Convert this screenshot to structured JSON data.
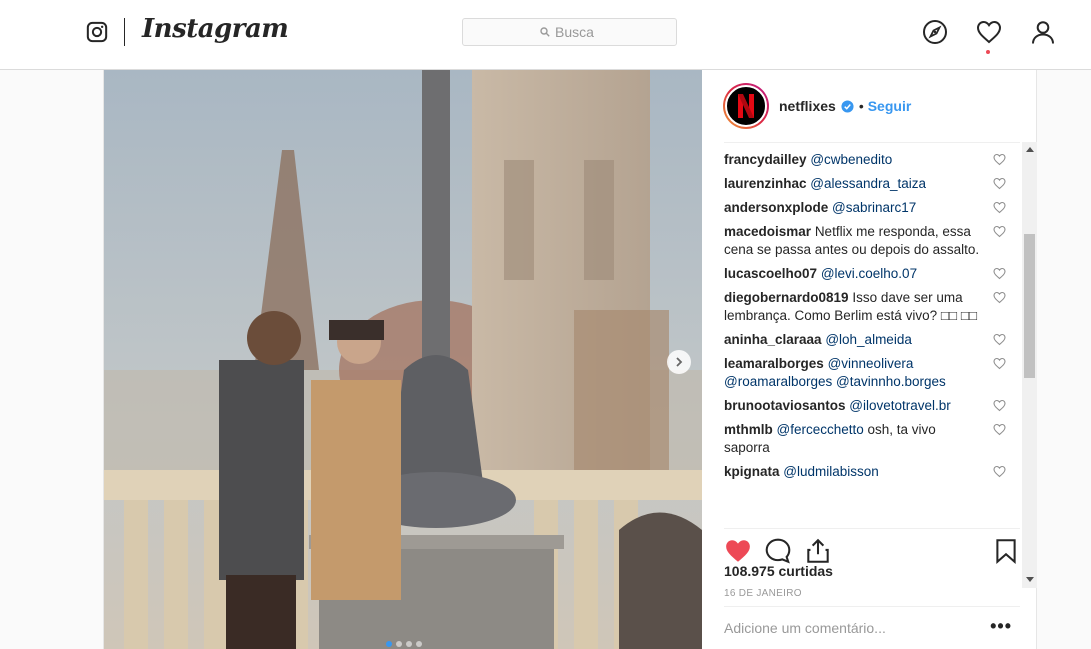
{
  "topbar": {
    "logo_icon": "instagram-camera-icon",
    "brand": "Instagram",
    "search_placeholder": "Busca",
    "nav_icons": [
      "compass-icon",
      "heart-icon",
      "person-icon"
    ]
  },
  "post": {
    "account": {
      "username": "netflixes",
      "verified": true,
      "separator": "•",
      "follow_label": "Seguir"
    },
    "carousel": {
      "slides": 4,
      "active_index": 0
    },
    "comments": [
      {
        "user": "francydailley",
        "text": "",
        "mentions": [
          "@cwbenedito"
        ]
      },
      {
        "user": "laurenzinhac",
        "text": "",
        "mentions": [
          "@alessandra_taiza"
        ]
      },
      {
        "user": "andersonxplode",
        "text": "",
        "mentions": [
          "@sabrinarc17"
        ]
      },
      {
        "user": "macedoismar",
        "text": "Netflix me responda, essa cena se passa antes ou depois do assalto.",
        "mentions": []
      },
      {
        "user": "lucascoelho07",
        "text": "",
        "mentions": [
          "@levi.coelho.07"
        ]
      },
      {
        "user": "diegobernardo0819",
        "text": "Isso dave ser uma lembrança. Como Berlim está vivo? □□ □□",
        "mentions": []
      },
      {
        "user": "aninha_claraaa",
        "text": "",
        "mentions": [
          "@loh_almeida"
        ]
      },
      {
        "user": "leamaralborges",
        "text": "",
        "mentions": [
          "@vinneolivera",
          "@roamaralborges",
          "@tavinnho.borges"
        ]
      },
      {
        "user": "brunootaviosantos",
        "text": "",
        "mentions": [
          "@ilovetotravel.br"
        ]
      },
      {
        "user": "mthmlb",
        "text": "osh, ta vivo saporra",
        "mentions": [
          "@fercecchetto"
        ]
      },
      {
        "user": "kpignata",
        "text": "",
        "mentions": [
          "@ludmilabisson"
        ]
      }
    ],
    "likes_text": "108.975 curtidas",
    "date_text": "16 DE JANEIRO",
    "add_comment_placeholder": "Adicione um comentário...",
    "more_label": "•••",
    "liked": true,
    "colors": {
      "like": "#ed4956",
      "link": "#3897f0",
      "mention": "#003569"
    }
  }
}
